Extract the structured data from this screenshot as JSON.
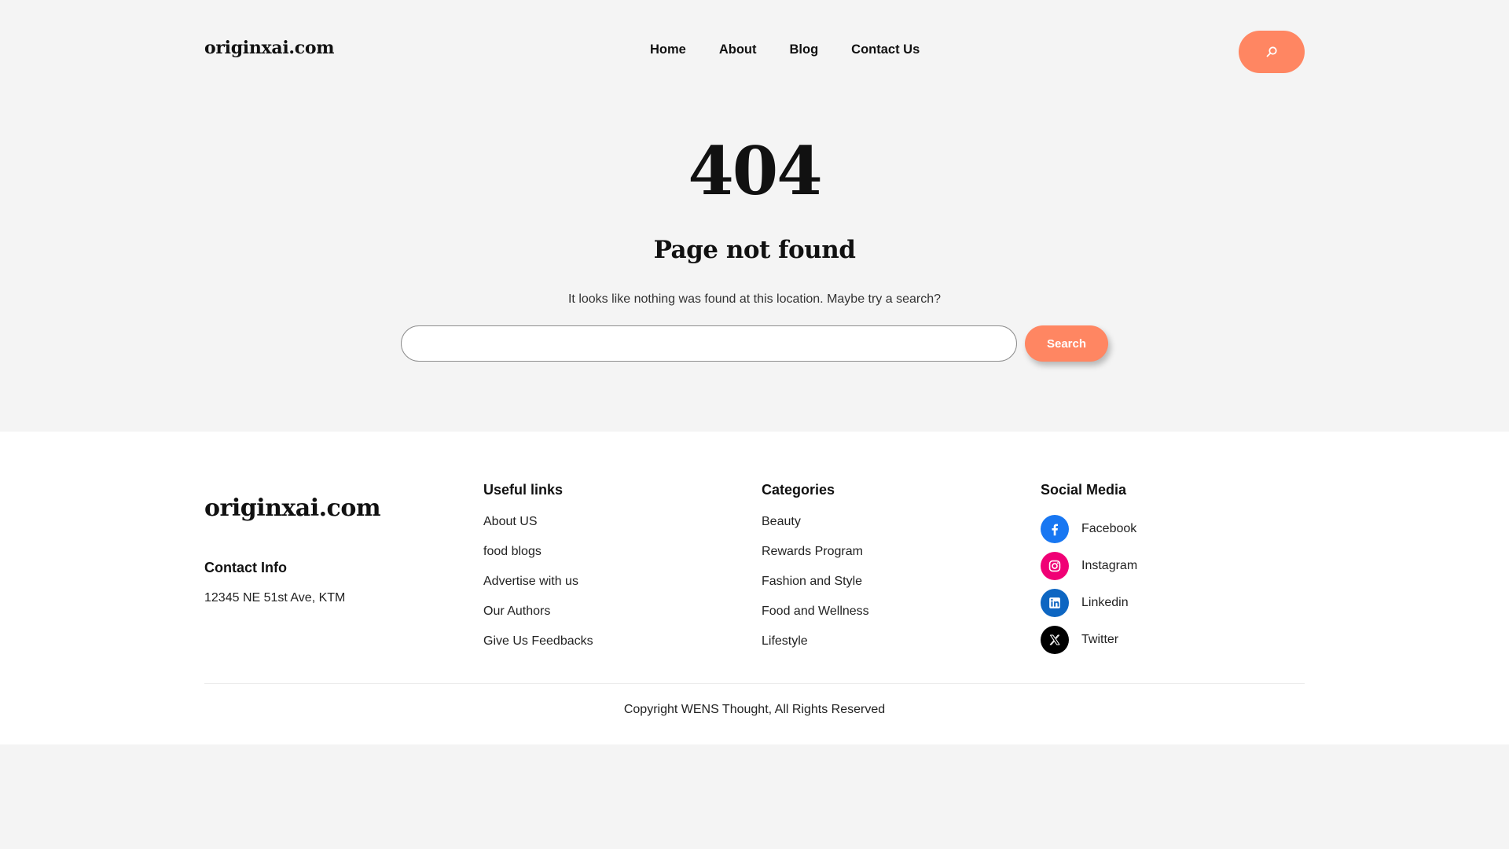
{
  "header": {
    "logo": "originxai.com",
    "nav": [
      "Home",
      "About",
      "Blog",
      "Contact Us"
    ],
    "search_icon": "search-icon"
  },
  "error": {
    "code": "404",
    "title": "Page not found",
    "message": "It looks like nothing was found at this location. Maybe try a search?",
    "search_placeholder": "",
    "search_button": "Search"
  },
  "footer": {
    "logo": "originxai.com",
    "contact_heading": "Contact Info",
    "address": "12345 NE 51st Ave, KTM",
    "useful_heading": "Useful links",
    "useful_links": [
      "About US",
      "food blogs",
      "Advertise with us",
      "Our Authors",
      "Give Us Feedbacks"
    ],
    "categories_heading": "Categories",
    "categories": [
      "Beauty",
      "Rewards Program",
      "Fashion and Style",
      "Food and Wellness",
      "Lifestyle"
    ],
    "social_heading": "Social Media",
    "social": [
      {
        "label": "Facebook",
        "icon": "facebook-icon",
        "color": "#1877f2"
      },
      {
        "label": "Instagram",
        "icon": "instagram-icon",
        "color": "#f00075"
      },
      {
        "label": "Linkedin",
        "icon": "linkedin-icon",
        "color": "#0d66c2"
      },
      {
        "label": "Twitter",
        "icon": "x-twitter-icon",
        "color": "#000000"
      }
    ],
    "copyright": "Copyright WENS Thought, All Rights Reserved"
  },
  "colors": {
    "accent": "#ff8662",
    "background": "#f4f4f4",
    "footer_bg": "#ffffff"
  }
}
